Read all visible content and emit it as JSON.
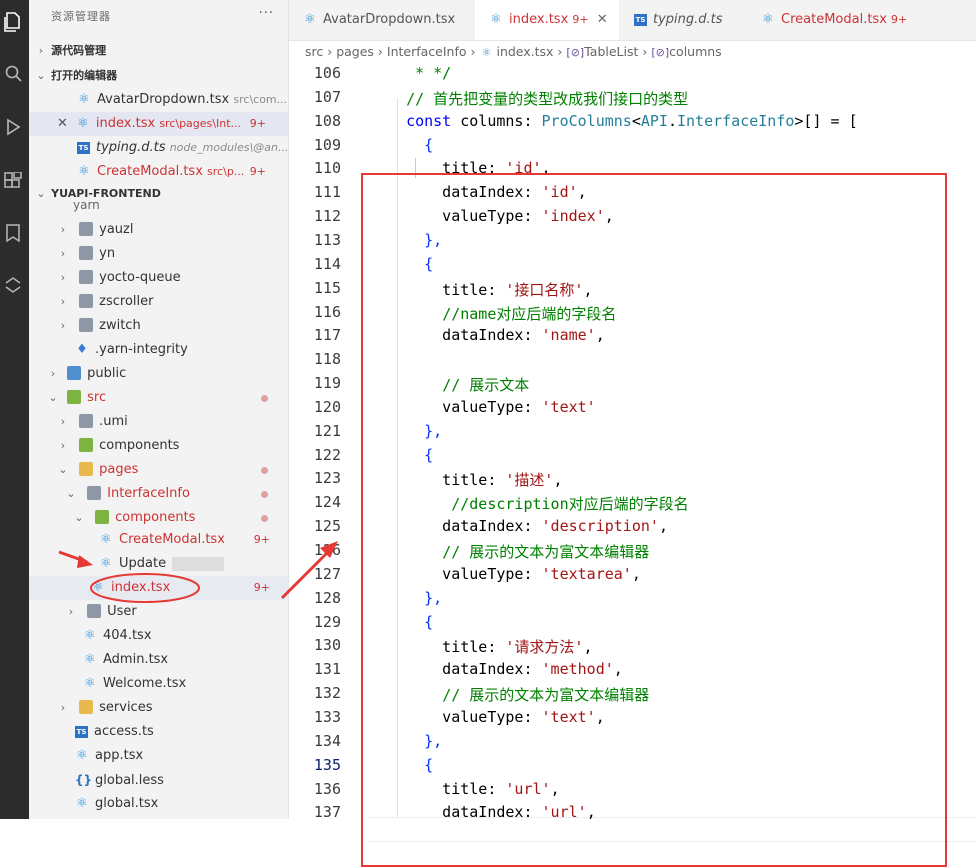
{
  "activity_bar": {
    "icons": [
      "files-icon",
      "search-icon",
      "run-debug-icon",
      "extensions-icon",
      "bookmark-icon",
      "remote-icon"
    ]
  },
  "sidebar": {
    "title": "资源管理器",
    "more": "···",
    "source_control": "源代码管理",
    "open_editors": {
      "header": "打开的编辑器",
      "items": [
        {
          "name": "AvatarDropdown.tsx",
          "path": "src\\com...",
          "badge": ""
        },
        {
          "name": "index.tsx",
          "path": "src\\pages\\Int...",
          "badge": "9+"
        },
        {
          "name": "typing.d.ts",
          "path": "node_modules\\@an...",
          "badge": ""
        },
        {
          "name": "CreateModal.tsx",
          "path": "src\\p...",
          "badge": "9+"
        }
      ]
    },
    "project": {
      "header": "YUAPI-FRONTEND",
      "items": [
        {
          "name": "yarn"
        },
        {
          "name": "yauzl"
        },
        {
          "name": "yn"
        },
        {
          "name": "yocto-queue"
        },
        {
          "name": "zscroller"
        },
        {
          "name": "zwitch"
        },
        {
          "name": ".yarn-integrity"
        },
        {
          "name": "public"
        },
        {
          "name": "src"
        },
        {
          "name": ".umi"
        },
        {
          "name": "components"
        },
        {
          "name": "pages"
        },
        {
          "name": "InterfaceInfo"
        },
        {
          "name": "components"
        },
        {
          "name": "CreateModal.tsx",
          "badge": "9+"
        },
        {
          "name": "Update"
        },
        {
          "name": "index.tsx",
          "badge": "9+"
        },
        {
          "name": "User"
        },
        {
          "name": "404.tsx"
        },
        {
          "name": "Admin.tsx"
        },
        {
          "name": "Welcome.tsx"
        },
        {
          "name": "services"
        },
        {
          "name": "access.ts"
        },
        {
          "name": "app.tsx"
        },
        {
          "name": "global.less"
        },
        {
          "name": "global.tsx"
        }
      ]
    }
  },
  "tabs": [
    {
      "name": "AvatarDropdown.tsx",
      "badge": ""
    },
    {
      "name": "index.tsx",
      "badge": "9+"
    },
    {
      "name": "typing.d.ts",
      "badge": ""
    },
    {
      "name": "CreateModal.tsx",
      "badge": "9+"
    }
  ],
  "breadcrumb": [
    "src",
    "pages",
    "InterfaceInfo",
    "index.tsx",
    "TableList",
    "columns"
  ],
  "code": {
    "lines": [
      {
        "n": "106",
        "t": "   * */"
      },
      {
        "n": "107",
        "t": "  // 首先把变量的类型改成我们接口的类型"
      },
      {
        "n": "108",
        "t": "  const columns: ProColumns<API.InterfaceInfo>[] = ["
      },
      {
        "n": "109",
        "t": "    {"
      },
      {
        "n": "110",
        "t": "      title: 'id',"
      },
      {
        "n": "111",
        "t": "      dataIndex: 'id',"
      },
      {
        "n": "112",
        "t": "      valueType: 'index',"
      },
      {
        "n": "113",
        "t": "    },"
      },
      {
        "n": "114",
        "t": "    {"
      },
      {
        "n": "115",
        "t": "      title: '接口名称',"
      },
      {
        "n": "116",
        "t": "      //name对应后端的字段名"
      },
      {
        "n": "117",
        "t": "      dataIndex: 'name',"
      },
      {
        "n": "118",
        "t": ""
      },
      {
        "n": "119",
        "t": "      // 展示文本"
      },
      {
        "n": "120",
        "t": "      valueType: 'text'"
      },
      {
        "n": "121",
        "t": "    },"
      },
      {
        "n": "122",
        "t": "    {"
      },
      {
        "n": "123",
        "t": "      title: '描述',"
      },
      {
        "n": "124",
        "t": "       //description对应后端的字段名"
      },
      {
        "n": "125",
        "t": "      dataIndex: 'description',"
      },
      {
        "n": "126",
        "t": "      // 展示的文本为富文本编辑器"
      },
      {
        "n": "127",
        "t": "      valueType: 'textarea',"
      },
      {
        "n": "128",
        "t": "    },"
      },
      {
        "n": "129",
        "t": "    {"
      },
      {
        "n": "130",
        "t": "      title: '请求方法',"
      },
      {
        "n": "131",
        "t": "      dataIndex: 'method',"
      },
      {
        "n": "132",
        "t": "      // 展示的文本为富文本编辑器"
      },
      {
        "n": "133",
        "t": "      valueType: 'text',"
      },
      {
        "n": "134",
        "t": "    },"
      },
      {
        "n": "135",
        "t": "    {"
      },
      {
        "n": "136",
        "t": "      title: 'url',"
      },
      {
        "n": "137",
        "t": "      dataIndex: 'url',"
      }
    ],
    "current_line": "135"
  },
  "colors": {
    "accent_red": "#e53935",
    "keyword": "#0000ff",
    "string": "#a31515",
    "comment": "#008000",
    "type": "#267f99"
  }
}
